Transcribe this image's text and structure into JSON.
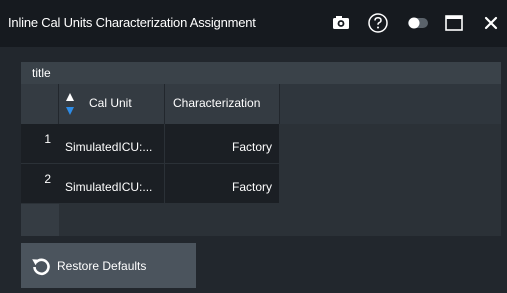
{
  "window": {
    "title": "Inline Cal Units Characterization Assignment",
    "icons": [
      "camera-icon",
      "help-icon",
      "toggle-icon",
      "maximize-icon",
      "close-icon"
    ]
  },
  "table": {
    "title": "title",
    "columns": {
      "cal_unit": "Cal Unit",
      "characterization": "Characterization"
    },
    "sort_indicator": "ascending",
    "rows": [
      {
        "index": "1",
        "cal_unit": "SimulatedICU:...",
        "characterization": "Factory"
      },
      {
        "index": "2",
        "cal_unit": "SimulatedICU:...",
        "characterization": "Factory"
      }
    ]
  },
  "footer": {
    "restore_label": "Restore Defaults",
    "restore_icon": "undo-icon"
  },
  "colors": {
    "titlebar": "#161a1f",
    "background": "#22272d",
    "table_header": "#3a4249",
    "cell": "#1b1f24",
    "button": "#4b545d",
    "sort_up": "#ffffff",
    "sort_down": "#2e8ce6"
  }
}
